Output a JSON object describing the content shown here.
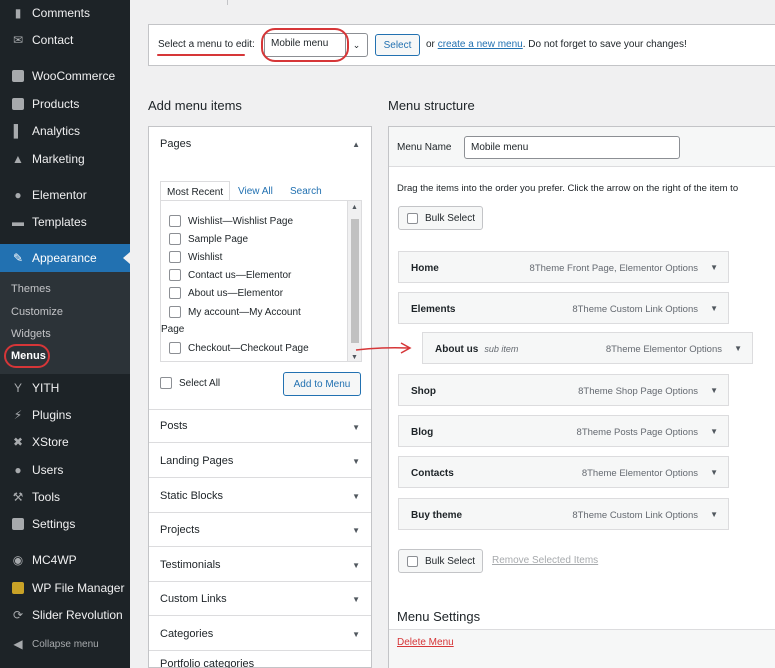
{
  "sidebar": {
    "items": [
      {
        "label": "Comments",
        "icon": "comment-icon"
      },
      {
        "label": "Contact",
        "icon": "mail-icon"
      },
      {
        "label": "WooCommerce",
        "icon": "woocommerce-icon"
      },
      {
        "label": "Products",
        "icon": "archive-icon"
      },
      {
        "label": "Analytics",
        "icon": "bar-chart-icon"
      },
      {
        "label": "Marketing",
        "icon": "megaphone-icon"
      },
      {
        "label": "Elementor",
        "icon": "elementor-icon"
      },
      {
        "label": "Templates",
        "icon": "folder-icon"
      },
      {
        "label": "Appearance",
        "icon": "paintbrush-icon"
      },
      {
        "label": "YITH",
        "icon": "yith-icon"
      },
      {
        "label": "Plugins",
        "icon": "plug-icon"
      },
      {
        "label": "XStore",
        "icon": "xstore-icon"
      },
      {
        "label": "Users",
        "icon": "user-icon"
      },
      {
        "label": "Tools",
        "icon": "wrench-icon"
      },
      {
        "label": "Settings",
        "icon": "settings-icon"
      },
      {
        "label": "MC4WP",
        "icon": "mc4wp-icon"
      },
      {
        "label": "WP File Manager",
        "icon": "file-manager-icon"
      },
      {
        "label": "Slider Revolution",
        "icon": "refresh-icon"
      },
      {
        "label": "Collapse menu",
        "icon": "collapse-icon"
      }
    ],
    "submenu": [
      "Themes",
      "Customize",
      "Widgets",
      "Menus"
    ]
  },
  "topbar": {
    "select_label": "Select a menu to edit:",
    "selected_menu": "Mobile menu",
    "select_button": "Select",
    "or_text": "or",
    "create_link": "create a new menu",
    "save_note": ". Do not forget to save your changes!"
  },
  "add_items": {
    "heading": "Add menu items",
    "pages_label": "Pages",
    "tabs": [
      "Most Recent",
      "View All",
      "Search"
    ],
    "pages": [
      {
        "name": "Wishlist",
        "sep": " — ",
        "suffix": "Wishlist Page"
      },
      {
        "name": "Sample Page",
        "sep": "",
        "suffix": ""
      },
      {
        "name": "Wishlist",
        "sep": "",
        "suffix": ""
      },
      {
        "name": "Contact us",
        "sep": " — ",
        "suffix": "Elementor"
      },
      {
        "name": "About us",
        "sep": " — ",
        "suffix": "Elementor"
      },
      {
        "name": "My account",
        "sep": " — ",
        "suffix": "My Account"
      },
      {
        "name": "Page",
        "sep": "",
        "suffix": ""
      },
      {
        "name": "Checkout",
        "sep": " — ",
        "suffix": "Checkout Page"
      }
    ],
    "select_all": "Select All",
    "add_button": "Add to Menu",
    "sections": [
      "Posts",
      "Landing Pages",
      "Static Blocks",
      "Projects",
      "Testimonials",
      "Custom Links",
      "Categories",
      "Portfolio categories"
    ]
  },
  "structure": {
    "heading": "Menu structure",
    "menu_name_label": "Menu Name",
    "menu_name_value": "Mobile menu",
    "drag_note": "Drag the items into the order you prefer. Click the arrow on the right of the item to",
    "bulk_select": "Bulk Select",
    "items": [
      {
        "title": "Home",
        "sub": "",
        "type": "8Theme Front Page, Elementor Options"
      },
      {
        "title": "Elements",
        "sub": "",
        "type": "8Theme Custom Link Options"
      },
      {
        "title": "About us",
        "sub": "sub item",
        "type": "8Theme Elementor Options"
      },
      {
        "title": "Shop",
        "sub": "",
        "type": "8Theme Shop Page Options"
      },
      {
        "title": "Blog",
        "sub": "",
        "type": "8Theme Posts Page Options"
      },
      {
        "title": "Contacts",
        "sub": "",
        "type": "8Theme Elementor Options"
      },
      {
        "title": "Buy theme",
        "sub": "",
        "type": "8Theme Custom Link Options"
      }
    ],
    "remove_selected": "Remove Selected Items",
    "menu_settings": "Menu Settings",
    "delete_menu": "Delete Menu"
  },
  "colors": {
    "admin_bar": "#1d2327",
    "accent": "#2271b1",
    "annotation": "#d63638"
  }
}
